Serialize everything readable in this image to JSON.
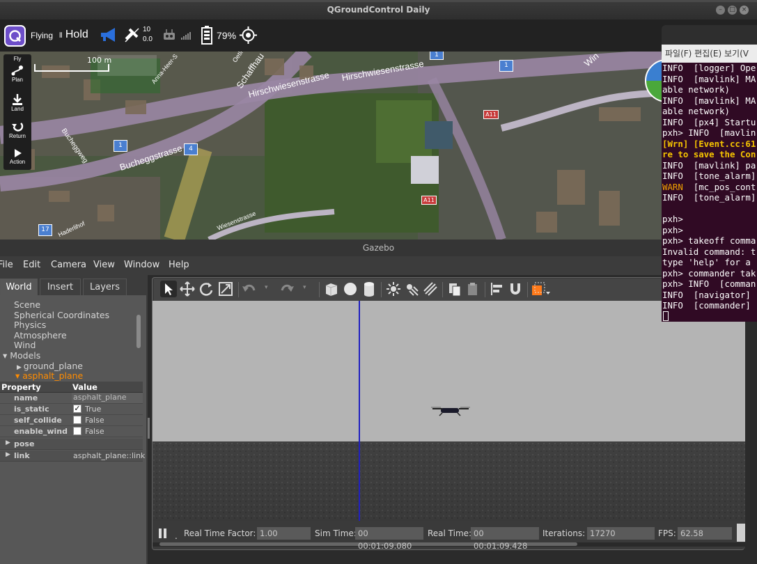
{
  "qgc": {
    "title": "QGroundControl Daily",
    "flight_mode": "Flying",
    "hold_label": "Hold",
    "gps_count": "10",
    "gps_hdop": "0.0",
    "battery": "79%",
    "scale_label": "100 m",
    "tools": [
      {
        "label": "Fly",
        "icon": "fly-icon"
      },
      {
        "label": "Plan",
        "icon": "plan-icon"
      },
      {
        "label": "Land",
        "icon": "land-icon"
      },
      {
        "label": "Return",
        "icon": "return-icon"
      },
      {
        "label": "Action",
        "icon": "action-icon"
      }
    ],
    "map_labels": {
      "street1": "Hirschwiesenstrasse",
      "street2": "Hirschwiesenstrasse",
      "street3": "Bucheggstrasse",
      "street4": "Schaffhau",
      "street5": "Bucheggweg",
      "street6": "Wiesenstrasse",
      "street7": "Haderlihof",
      "street8": "Anna-Heer-S",
      "street9": "Oetli",
      "street10": "Win",
      "a11_1": "A11",
      "a11_2": "A11",
      "marker1": "1",
      "marker2": "1",
      "marker3": "1",
      "marker4": "4",
      "marker5": "17"
    }
  },
  "gazebo": {
    "title": "Gazebo",
    "menu": [
      "File",
      "Edit",
      "Camera",
      "View",
      "Window",
      "Help"
    ],
    "tabs": [
      "World",
      "Insert",
      "Layers"
    ],
    "tree": [
      "Scene",
      "Spherical Coordinates",
      "Physics",
      "Atmosphere",
      "Wind",
      "Models",
      "ground_plane",
      "asphalt_plane"
    ],
    "prop_header": {
      "property": "Property",
      "value": "Value"
    },
    "props": [
      {
        "name": "name",
        "value": "asphalt_plane"
      },
      {
        "name": "is_static",
        "value": "True"
      },
      {
        "name": "self_collide",
        "value": "False"
      },
      {
        "name": "enable_wind",
        "value": "False"
      }
    ],
    "groups": [
      {
        "name": "pose",
        "value": ""
      },
      {
        "name": "link",
        "value": "asphalt_plane::link"
      }
    ],
    "status": {
      "rtf_label": "Real Time Factor:",
      "rtf": "1.00",
      "sim_label": "Sim Time:",
      "sim": "00 00:01:09.080",
      "real_label": "Real Time:",
      "real": "00 00:01:09.428",
      "iter_label": "Iterations:",
      "iter": "17270",
      "fps_label": "FPS:",
      "fps": "62.58"
    },
    "colors": {
      "selected": "#ff8c00",
      "ground": "#3d3d3d",
      "sky": "#b3b3b3"
    }
  },
  "terminal": {
    "menu": "파일(F)  편집(E)  보기(V",
    "lines": [
      {
        "text": "INFO  [logger] Ope",
        "style": "normal"
      },
      {
        "text": "INFO  [mavlink] MA",
        "style": "normal"
      },
      {
        "text": "able network)",
        "style": "normal"
      },
      {
        "text": "INFO  [mavlink] MA",
        "style": "normal"
      },
      {
        "text": "able network)",
        "style": "normal"
      },
      {
        "text": "INFO  [px4] Startu",
        "style": "normal"
      },
      {
        "text": "pxh> INFO  [mavlin",
        "style": "normal"
      },
      {
        "text": "[Wrn] [Event.cc:61",
        "style": "yellow"
      },
      {
        "text": "re to save the Con",
        "style": "yellow"
      },
      {
        "text": "INFO  [mavlink] pa",
        "style": "normal"
      },
      {
        "text": "INFO  [tone_alarm]",
        "style": "normal"
      },
      {
        "text": "WARN  [mc_pos_cont",
        "style": "warn"
      },
      {
        "text": "INFO  [tone_alarm]",
        "style": "normal"
      },
      {
        "text": "",
        "style": "normal"
      },
      {
        "text": "pxh>",
        "style": "normal"
      },
      {
        "text": "pxh>",
        "style": "normal"
      },
      {
        "text": "pxh> takeoff comma",
        "style": "normal"
      },
      {
        "text": "Invalid command: t",
        "style": "normal"
      },
      {
        "text": "type 'help' for a",
        "style": "normal"
      },
      {
        "text": "pxh> commander tak",
        "style": "normal"
      },
      {
        "text": "pxh> INFO  [comman",
        "style": "normal"
      },
      {
        "text": "INFO  [navigator]",
        "style": "normal"
      },
      {
        "text": "INFO  [commander]",
        "style": "normal"
      }
    ]
  }
}
